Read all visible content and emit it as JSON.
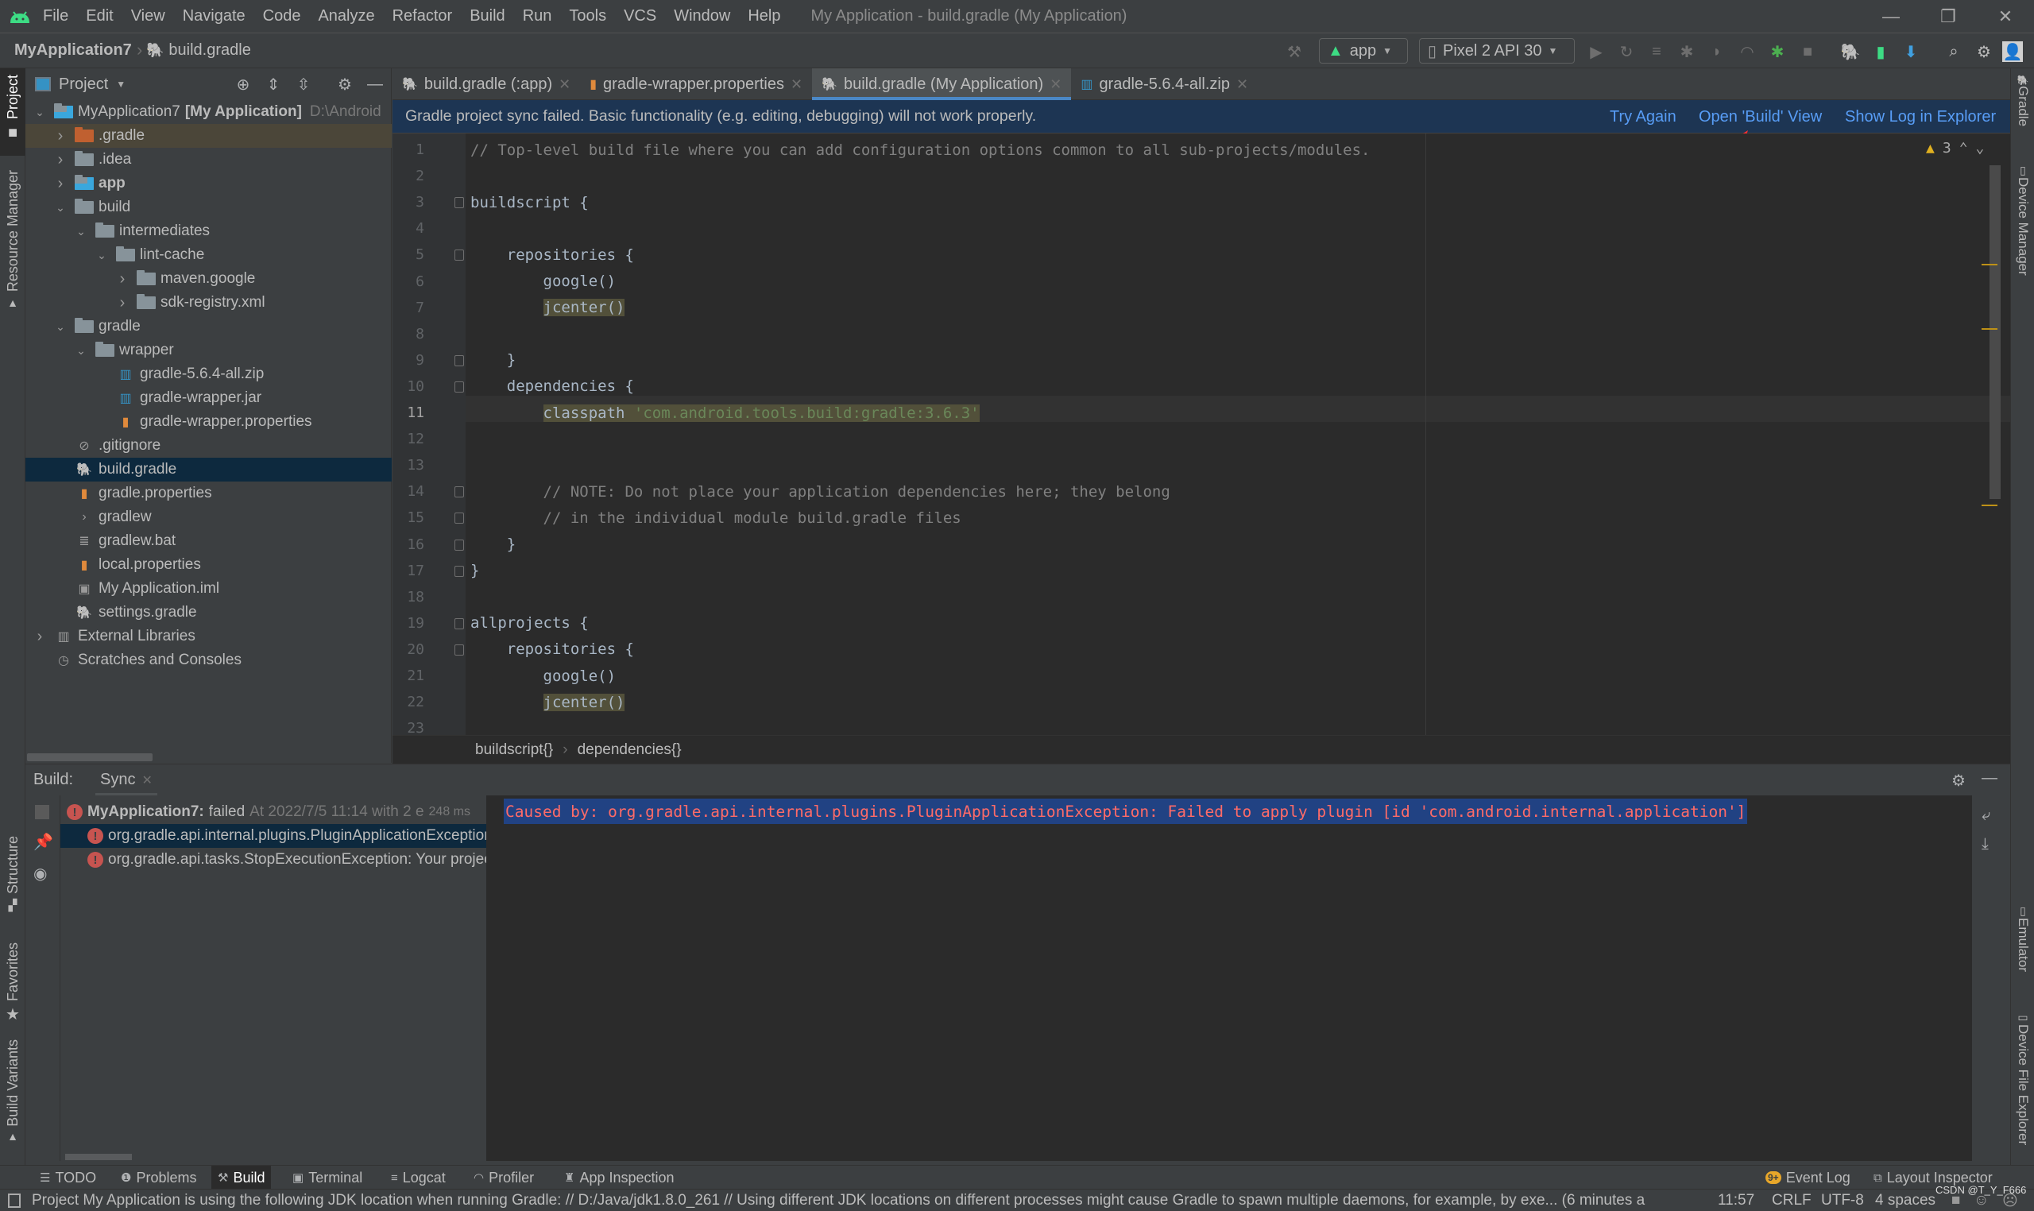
{
  "window": {
    "title": "My Application - build.gradle (My Application)",
    "menu": [
      "File",
      "Edit",
      "View",
      "Navigate",
      "Code",
      "Analyze",
      "Refactor",
      "Build",
      "Run",
      "Tools",
      "VCS",
      "Window",
      "Help"
    ],
    "controls": {
      "minimize": "—",
      "restore": "❐",
      "close": "✕"
    }
  },
  "navbar": {
    "project": "MyApplication7",
    "file": "build.gradle",
    "run_config": "app",
    "device": "Pixel 2 API 30"
  },
  "left_stripe": [
    "Project",
    "Resource Manager",
    "Structure",
    "Favorites",
    "Build Variants"
  ],
  "right_stripe": [
    "Gradle",
    "Device Manager",
    "Emulator",
    "Device File Explorer"
  ],
  "project_panel": {
    "title": "Project",
    "tree": [
      {
        "label": "MyApplication7",
        "bold_suffix": "[My Application]",
        "path": "D:\\Android",
        "depth": 0,
        "expanded": true,
        "icon": "module-folder"
      },
      {
        "label": ".gradle",
        "depth": 1,
        "expanded": false,
        "icon": "folder-excluded",
        "highlight": true
      },
      {
        "label": ".idea",
        "depth": 1,
        "expanded": false,
        "icon": "folder"
      },
      {
        "label": "app",
        "depth": 1,
        "expanded": false,
        "icon": "module-folder",
        "bold": true
      },
      {
        "label": "build",
        "depth": 1,
        "expanded": true,
        "icon": "folder"
      },
      {
        "label": "intermediates",
        "depth": 2,
        "expanded": true,
        "icon": "folder"
      },
      {
        "label": "lint-cache",
        "depth": 3,
        "expanded": true,
        "icon": "folder"
      },
      {
        "label": "maven.google",
        "depth": 4,
        "expanded": false,
        "icon": "folder"
      },
      {
        "label": "sdk-registry.xml",
        "depth": 4,
        "expanded": false,
        "icon": "folder"
      },
      {
        "label": "gradle",
        "depth": 1,
        "expanded": true,
        "icon": "folder"
      },
      {
        "label": "wrapper",
        "depth": 2,
        "expanded": true,
        "icon": "folder"
      },
      {
        "label": "gradle-5.6.4-all.zip",
        "depth": 3,
        "icon": "archive"
      },
      {
        "label": "gradle-wrapper.jar",
        "depth": 3,
        "icon": "archive"
      },
      {
        "label": "gradle-wrapper.properties",
        "depth": 3,
        "icon": "properties"
      },
      {
        "label": ".gitignore",
        "depth": 1,
        "icon": "ignore-file"
      },
      {
        "label": "build.gradle",
        "depth": 1,
        "icon": "gradle",
        "selected": true
      },
      {
        "label": "gradle.properties",
        "depth": 1,
        "icon": "properties"
      },
      {
        "label": "gradlew",
        "depth": 1,
        "icon": "shell-script"
      },
      {
        "label": "gradlew.bat",
        "depth": 1,
        "icon": "text-file"
      },
      {
        "label": "local.properties",
        "depth": 1,
        "icon": "properties"
      },
      {
        "label": "My Application.iml",
        "depth": 1,
        "icon": "module-file"
      },
      {
        "label": "settings.gradle",
        "depth": 1,
        "icon": "gradle"
      },
      {
        "label": "External Libraries",
        "depth": 0,
        "expanded": false,
        "icon": "libraries"
      },
      {
        "label": "Scratches and Consoles",
        "depth": 0,
        "icon": "scratches"
      }
    ]
  },
  "tabs": [
    {
      "label": "build.gradle (:app)",
      "icon": "gradle"
    },
    {
      "label": "gradle-wrapper.properties",
      "icon": "properties"
    },
    {
      "label": "build.gradle (My Application)",
      "icon": "gradle",
      "active": true
    },
    {
      "label": "gradle-5.6.4-all.zip",
      "icon": "archive"
    }
  ],
  "banner": {
    "message": "Gradle project sync failed. Basic functionality (e.g. editing, debugging) will not work properly.",
    "links": [
      "Try Again",
      "Open 'Build' View",
      "Show Log in Explorer"
    ]
  },
  "editor": {
    "warnings_count": "3",
    "current_line": 11,
    "lines": [
      {
        "n": "1",
        "segs": [
          {
            "t": "// Top-level build file where you can add configuration options common to all sub-projects/modules.",
            "c": "cmt"
          }
        ]
      },
      {
        "n": "2",
        "segs": []
      },
      {
        "n": "3",
        "segs": [
          {
            "t": "buildscript {"
          }
        ]
      },
      {
        "n": "4",
        "segs": []
      },
      {
        "n": "5",
        "segs": [
          {
            "t": "    repositories {"
          }
        ]
      },
      {
        "n": "6",
        "segs": [
          {
            "t": "        google()"
          }
        ]
      },
      {
        "n": "7",
        "segs": [
          {
            "t": "        "
          },
          {
            "t": "jcenter()",
            "c": "hlbg"
          }
        ]
      },
      {
        "n": "8",
        "segs": []
      },
      {
        "n": "9",
        "segs": [
          {
            "t": "    }"
          }
        ]
      },
      {
        "n": "10",
        "segs": [
          {
            "t": "    dependencies {"
          }
        ]
      },
      {
        "n": "11",
        "segs": [
          {
            "t": "        "
          },
          {
            "t": "classpath ",
            "c": "hlbg"
          },
          {
            "t": "'com.android.tools.build:gradle:3.6.3'",
            "c": "str hlbg"
          }
        ]
      },
      {
        "n": "12",
        "segs": []
      },
      {
        "n": "13",
        "segs": []
      },
      {
        "n": "14",
        "segs": [
          {
            "t": "        // NOTE: Do not place your application dependencies here; they belong",
            "c": "cmt"
          }
        ]
      },
      {
        "n": "15",
        "segs": [
          {
            "t": "        // in the individual module build.gradle files",
            "c": "cmt"
          }
        ]
      },
      {
        "n": "16",
        "segs": [
          {
            "t": "    }"
          }
        ]
      },
      {
        "n": "17",
        "segs": [
          {
            "t": "}"
          }
        ]
      },
      {
        "n": "18",
        "segs": []
      },
      {
        "n": "19",
        "segs": [
          {
            "t": "allprojects {"
          }
        ]
      },
      {
        "n": "20",
        "segs": [
          {
            "t": "    repositories {"
          }
        ]
      },
      {
        "n": "21",
        "segs": [
          {
            "t": "        google()"
          }
        ]
      },
      {
        "n": "22",
        "segs": [
          {
            "t": "        "
          },
          {
            "t": "jcenter()",
            "c": "hlbg"
          }
        ]
      },
      {
        "n": "23",
        "segs": []
      }
    ],
    "breadcrumbs": [
      "buildscript{}",
      "dependencies{}"
    ]
  },
  "build_panel": {
    "label": "Build:",
    "tab": "Sync",
    "tree": [
      {
        "title": "MyApplication7:",
        "status": "failed",
        "detail": "At 2022/7/5 11:14 with 2 e",
        "duration": "248 ms",
        "depth": 0
      },
      {
        "title": "org.gradle.api.internal.plugins.PluginApplicationException: Failed to apply plugin [id 'com.android.internal.application']",
        "depth": 1,
        "selected": true
      },
      {
        "title": "org.gradle.api.tasks.StopExecutionException: Your project path contains non-ASCII characters",
        "depth": 1
      }
    ],
    "console": "Caused by: org.gradle.api.internal.plugins.PluginApplicationException: Failed to apply plugin [id 'com.android.internal.application']"
  },
  "tool_tabs": {
    "left": [
      {
        "label": "TODO",
        "icon": "list-icon"
      },
      {
        "label": "Problems",
        "icon": "problems-icon"
      },
      {
        "label": "Build",
        "icon": "hammer-icon",
        "active": true
      },
      {
        "label": "Terminal",
        "icon": "terminal-icon"
      },
      {
        "label": "Logcat",
        "icon": "logcat-icon"
      },
      {
        "label": "Profiler",
        "icon": "profiler-icon"
      },
      {
        "label": "App Inspection",
        "icon": "inspection-icon"
      }
    ],
    "right": [
      {
        "label": "Event Log",
        "badge": "9+"
      },
      {
        "label": "Layout Inspector"
      }
    ]
  },
  "status_bar": {
    "message": "Project My Application is using the following JDK location when running Gradle: // D:/Java/jdk1.8.0_261 // Using different JDK locations on different processes might cause Gradle to spawn multiple daemons, for example, by exe... (6 minutes a",
    "position": "11:57",
    "line_sep": "CRLF",
    "encoding": "UTF-8",
    "indent": "4 spaces"
  },
  "watermark": "CSDN @T_Y_F666"
}
